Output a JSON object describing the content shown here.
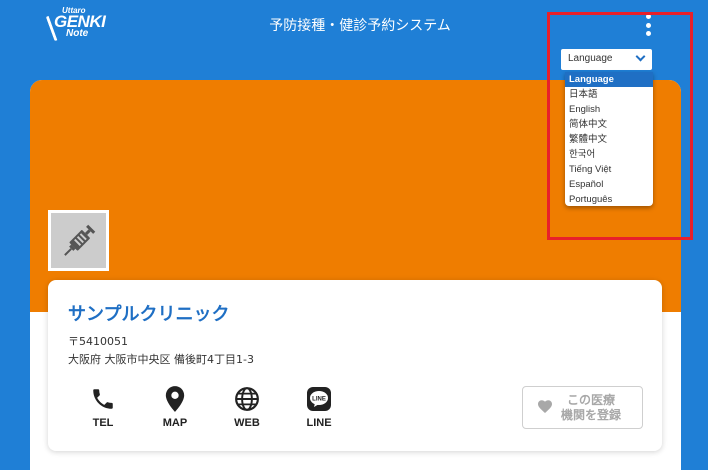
{
  "header": {
    "logo": {
      "line1": "Uttaro",
      "line2": "GENKI",
      "line3": "Note"
    },
    "title": "予防接種・健診予約システム",
    "menu_icon": "kebab-menu-icon"
  },
  "language": {
    "selected_value": "Language",
    "options": [
      "Language",
      "日本語",
      "English",
      "简体中文",
      "繁體中文",
      "한국어",
      "Tiếng Việt",
      "Español",
      "Português"
    ]
  },
  "clinic": {
    "name": "サンプルクリニック",
    "postal": "〒5410051",
    "address": "大阪府 大阪市中央区 備後町4丁目1-3",
    "image_icon": "syringe-icon"
  },
  "actions": [
    {
      "label": "TEL",
      "icon": "phone-icon"
    },
    {
      "label": "MAP",
      "icon": "map-pin-icon"
    },
    {
      "label": "WEB",
      "icon": "globe-icon"
    },
    {
      "label": "LINE",
      "icon": "line-icon"
    }
  ],
  "register_button": {
    "line1": "この医療",
    "line2": "機関を登録",
    "icon": "heart-icon"
  },
  "colors": {
    "header_blue": "#1f7fd6",
    "banner_orange": "#ef7d00",
    "accent_blue": "#1f6fc4",
    "highlight_red": "#e8202a"
  }
}
